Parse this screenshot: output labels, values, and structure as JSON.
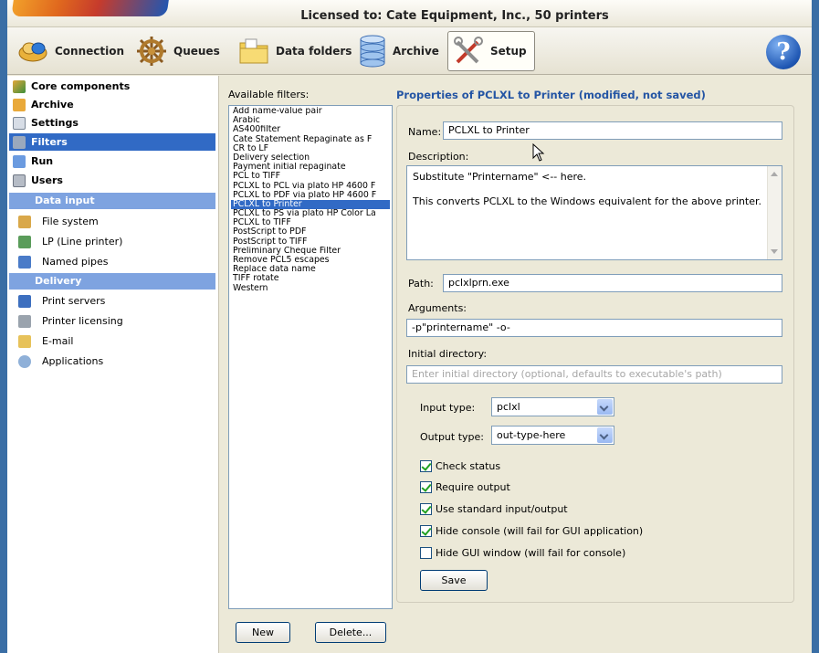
{
  "license": {
    "text": "Licensed to: Cate Equipment, Inc., 50 printers"
  },
  "toolbar": {
    "buttons": [
      {
        "label": "Connection",
        "icon": "connection-icon"
      },
      {
        "label": "Queues",
        "icon": "ship-wheel-icon"
      },
      {
        "label": "Data folders",
        "icon": "folder-icon"
      },
      {
        "label": "Archive",
        "icon": "database-icon"
      },
      {
        "label": "Setup",
        "icon": "tools-icon"
      }
    ],
    "help_label": "?"
  },
  "nav": {
    "items": [
      {
        "label": "Core components",
        "icon": "core-components-icon"
      },
      {
        "label": "Archive",
        "icon": "archive-icon"
      },
      {
        "label": "Settings",
        "icon": "settings-icon"
      },
      {
        "label": "Filters",
        "icon": "filter-icon"
      },
      {
        "label": "Run",
        "icon": "run-icon"
      },
      {
        "label": "Users",
        "icon": "users-icon"
      }
    ],
    "data_input": {
      "title": "Data input",
      "items": [
        {
          "label": "File system",
          "icon": "file-system-icon"
        },
        {
          "label": "LP (Line printer)",
          "icon": "line-printer-icon"
        },
        {
          "label": "Named pipes",
          "icon": "named-pipes-icon"
        }
      ]
    },
    "delivery": {
      "title": "Delivery",
      "items": [
        {
          "label": "Print servers",
          "icon": "print-server-icon"
        },
        {
          "label": "Printer licensing",
          "icon": "licensing-icon"
        },
        {
          "label": "E-mail",
          "icon": "email-icon"
        },
        {
          "label": "Applications",
          "icon": "applications-icon"
        }
      ]
    },
    "selected": "Filters"
  },
  "filters": {
    "label": "Available filters:",
    "items": [
      "Add name-value pair",
      "Arabic",
      "AS400filter",
      "Cate Statement Repaginate as F",
      "CR to LF",
      "Delivery selection",
      "Payment initial repaginate",
      "PCL to TIFF",
      "PCLXL to PCL via plato HP 4600 F",
      "PCLXL to PDF via plato HP 4600 F",
      "PCLXL to Printer",
      "PCLXL to PS via plato HP Color La",
      "PCLXL to TIFF",
      "PostScript to PDF",
      "PostScript to TIFF",
      "Preliminary Cheque Filter",
      "Remove PCL5 escapes",
      "Replace data name",
      "TIFF rotate",
      "Western"
    ],
    "selected": "PCLXL to Printer",
    "new_label": "New",
    "delete_label": "Delete..."
  },
  "props": {
    "title": "Properties of PCLXL to Printer (modified, not saved)",
    "name_label": "Name:",
    "name_value": "PCLXL to Printer",
    "description_label": "Description:",
    "description_line1": "Substitute \"Printername\" <-- here.",
    "description_line2": "This converts PCLXL to the Windows equivalent for the above printer.",
    "path_label": "Path:",
    "path_value": "pclxlprn.exe",
    "arguments_label": "Arguments:",
    "arguments_value": "-p\"printername\" -o-",
    "initial_dir_label": "Initial directory:",
    "initial_dir_placeholder": "Enter initial directory (optional, defaults to executable's path)",
    "input_type_label": "Input type:",
    "input_type_value": "pclxl",
    "output_type_label": "Output type:",
    "output_type_value": "out-type-here",
    "checkboxes": [
      {
        "label": "Check status",
        "checked": true
      },
      {
        "label": "Require output",
        "checked": true
      },
      {
        "label": "Use standard input/output",
        "checked": true
      },
      {
        "label": "Hide console (will fail for GUI application)",
        "checked": true
      },
      {
        "label": "Hide GUI window (will fail for console)",
        "checked": false
      }
    ],
    "save_label": "Save"
  }
}
